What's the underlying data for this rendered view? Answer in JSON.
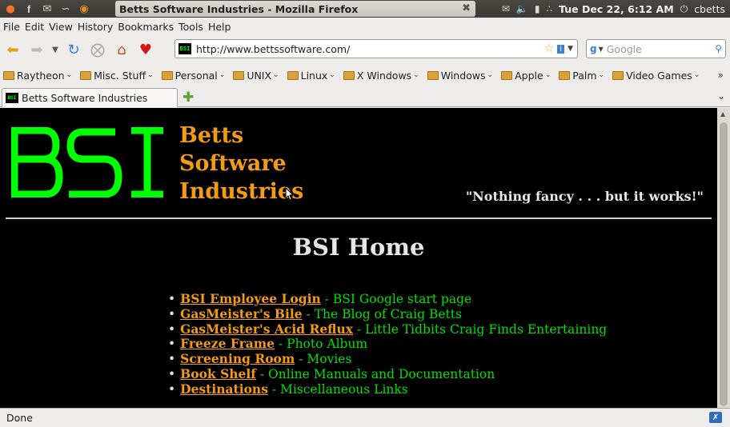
{
  "panel": {
    "window_title": "Betts Software Industries - Mozilla Firefox",
    "clock": "Tue Dec 22,  6:12 AM",
    "user": "cbetts"
  },
  "menubar": [
    "File",
    "Edit",
    "View",
    "History",
    "Bookmarks",
    "Tools",
    "Help"
  ],
  "navbar": {
    "url": "http://www.bettssoftware.com/",
    "search_placeholder": "Google"
  },
  "bookmarks": [
    "Raytheon",
    "Misc. Stuff",
    "Personal",
    "UNIX",
    "Linux",
    "X Windows",
    "Windows",
    "Apple",
    "Palm",
    "Video Games"
  ],
  "tab": {
    "title": "Betts Software Industries"
  },
  "page": {
    "logo_text": "BSI",
    "brand": [
      "Betts",
      "Software",
      "Industries"
    ],
    "tagline": "\"Nothing fancy . . . but it works!\"",
    "heading": "BSI Home",
    "links": [
      {
        "label": "BSI Employee Login",
        "desc": " - BSI Google start page"
      },
      {
        "label": "GasMeister's Bile",
        "desc": " - The Blog of Craig Betts"
      },
      {
        "label": "GasMeister's Acid Reflux",
        "desc": " - Little Tidbits Craig Finds Entertaining"
      },
      {
        "label": "Freeze Frame",
        "desc": " - Photo Album"
      },
      {
        "label": "Screening Room",
        "desc": " - Movies"
      },
      {
        "label": "Book Shelf",
        "desc": " - Online Manuals and Documentation"
      },
      {
        "label": "Destinations",
        "desc": " - Miscellaneous Links"
      }
    ]
  },
  "status": {
    "text": "Done"
  },
  "colors": {
    "accent": "#f39c12",
    "link_desc": "#00e000",
    "logo": "#00ff00",
    "background": "#000000"
  }
}
